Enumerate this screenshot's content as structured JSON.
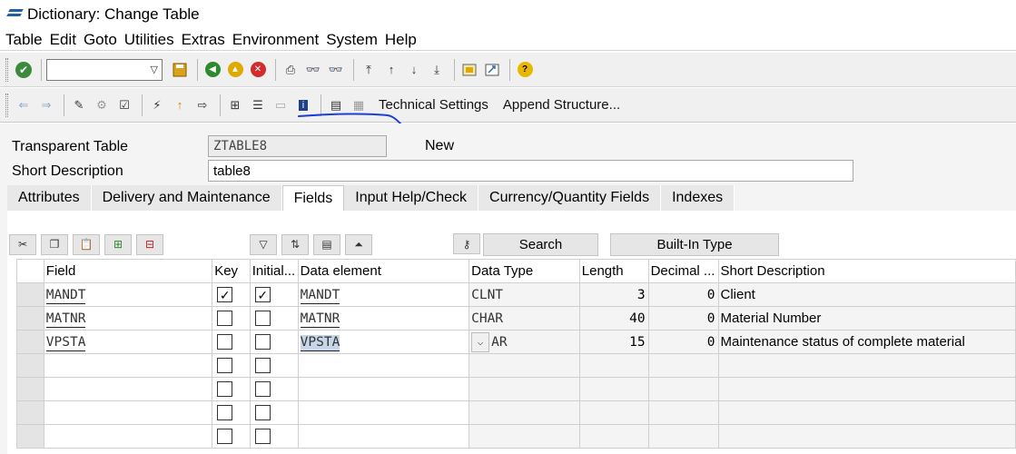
{
  "window": {
    "title": "Dictionary: Change Table"
  },
  "menu": [
    "Table",
    "Edit",
    "Goto",
    "Utilities",
    "Extras",
    "Environment",
    "System",
    "Help"
  ],
  "toolbar2": {
    "technical_settings": "Technical Settings",
    "append_structure": "Append Structure..."
  },
  "header": {
    "transparent_table_label": "Transparent Table",
    "table_name": "ZTABLE8",
    "status": "New",
    "short_description_label": "Short Description",
    "short_description": "table8"
  },
  "tabs": [
    {
      "label": "Attributes",
      "active": false
    },
    {
      "label": "Delivery and Maintenance",
      "active": false
    },
    {
      "label": "Fields",
      "active": true
    },
    {
      "label": "Input Help/Check",
      "active": false
    },
    {
      "label": "Currency/Quantity Fields",
      "active": false
    },
    {
      "label": "Indexes",
      "active": false
    }
  ],
  "grid_buttons": {
    "search": "Search",
    "builtin_type": "Built-In Type"
  },
  "columns": [
    "Field",
    "Key",
    "Initial...",
    "Data element",
    "Data Type",
    "Length",
    "Decimal ...",
    "Short Description"
  ],
  "rows": [
    {
      "field": "MANDT",
      "key": true,
      "initial": true,
      "data_element": "MANDT",
      "data_type": "CLNT",
      "length": "3",
      "decimal": "0",
      "short_description": "Client"
    },
    {
      "field": "MATNR",
      "key": false,
      "initial": false,
      "data_element": "MATNR",
      "data_type": "CHAR",
      "length": "40",
      "decimal": "0",
      "short_description": "Material Number"
    },
    {
      "field": "VPSTA",
      "key": false,
      "initial": false,
      "data_element": "VPSTA",
      "data_type": "AR",
      "length": "15",
      "decimal": "0",
      "short_description": "Maintenance status of complete material"
    }
  ],
  "colors": {
    "accent": "#1e5fa8",
    "annotation": "#1a3fd6",
    "selected_cell": "#c8d6ea"
  }
}
